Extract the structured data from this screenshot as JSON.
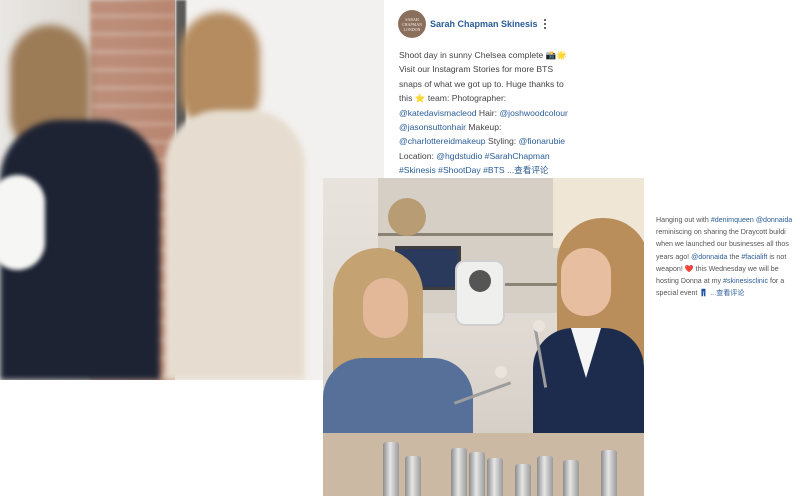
{
  "post": {
    "avatar_text": "SARAH CHAPMAN LONDON",
    "account_name": "Sarah Chapman Skinesis",
    "caption_lines": [
      [
        {
          "t": "Shoot day in sunny Chelsea complete 📸🌟"
        }
      ],
      [
        {
          "t": "Visit our Instagram Stories for more BTS"
        }
      ],
      [
        {
          "t": "snaps of what we got up to. Huge thanks to"
        }
      ],
      [
        {
          "t": "this ⭐ team: Photographer:"
        }
      ],
      [
        {
          "t": "@katedavismacleod",
          "link": true
        },
        {
          "t": " Hair: "
        },
        {
          "t": "@joshwoodcolour",
          "link": true
        }
      ],
      [
        {
          "t": "@jasonsuttonhair",
          "link": true
        },
        {
          "t": " Makeup:"
        }
      ],
      [
        {
          "t": "@charlottereidmakeup",
          "link": true
        },
        {
          "t": " Styling: "
        },
        {
          "t": "@fionarubie",
          "link": true
        }
      ],
      [
        {
          "t": "Location: "
        },
        {
          "t": "@hgdstudio",
          "link": true
        },
        {
          "t": " "
        },
        {
          "t": "#SarahChapman",
          "link": true
        }
      ],
      [
        {
          "t": "#Skinesis",
          "link": true
        },
        {
          "t": " "
        },
        {
          "t": "#ShootDay",
          "link": true
        },
        {
          "t": " "
        },
        {
          "t": "#BTS",
          "link": true
        },
        {
          "t": " ...查看评论",
          "link": true
        }
      ]
    ]
  },
  "side_post": {
    "caption_lines": [
      [
        {
          "t": "Hanging out with "
        },
        {
          "t": "#denimqueen",
          "link": true
        },
        {
          "t": " "
        },
        {
          "t": "@donnaida",
          "link": true
        }
      ],
      [
        {
          "t": "reminiscing on sharing the Draycott buildi"
        }
      ],
      [
        {
          "t": "when we launched our businesses all thos"
        }
      ],
      [
        {
          "t": "years ago! "
        },
        {
          "t": "@donnaida",
          "link": true
        },
        {
          "t": " the "
        },
        {
          "t": "#facialift",
          "link": true
        },
        {
          "t": " is not"
        }
      ],
      [
        {
          "t": "weapon! ❤️ this Wednesday we will be"
        }
      ],
      [
        {
          "t": "hosting Donna at my "
        },
        {
          "t": "#skinesisclinic",
          "link": true
        },
        {
          "t": " for a"
        }
      ],
      [
        {
          "t": "special event 👖 "
        },
        {
          "t": "...查看评论",
          "link": true
        }
      ]
    ]
  },
  "colors": {
    "link": "#2a5d98",
    "text": "#444444"
  }
}
